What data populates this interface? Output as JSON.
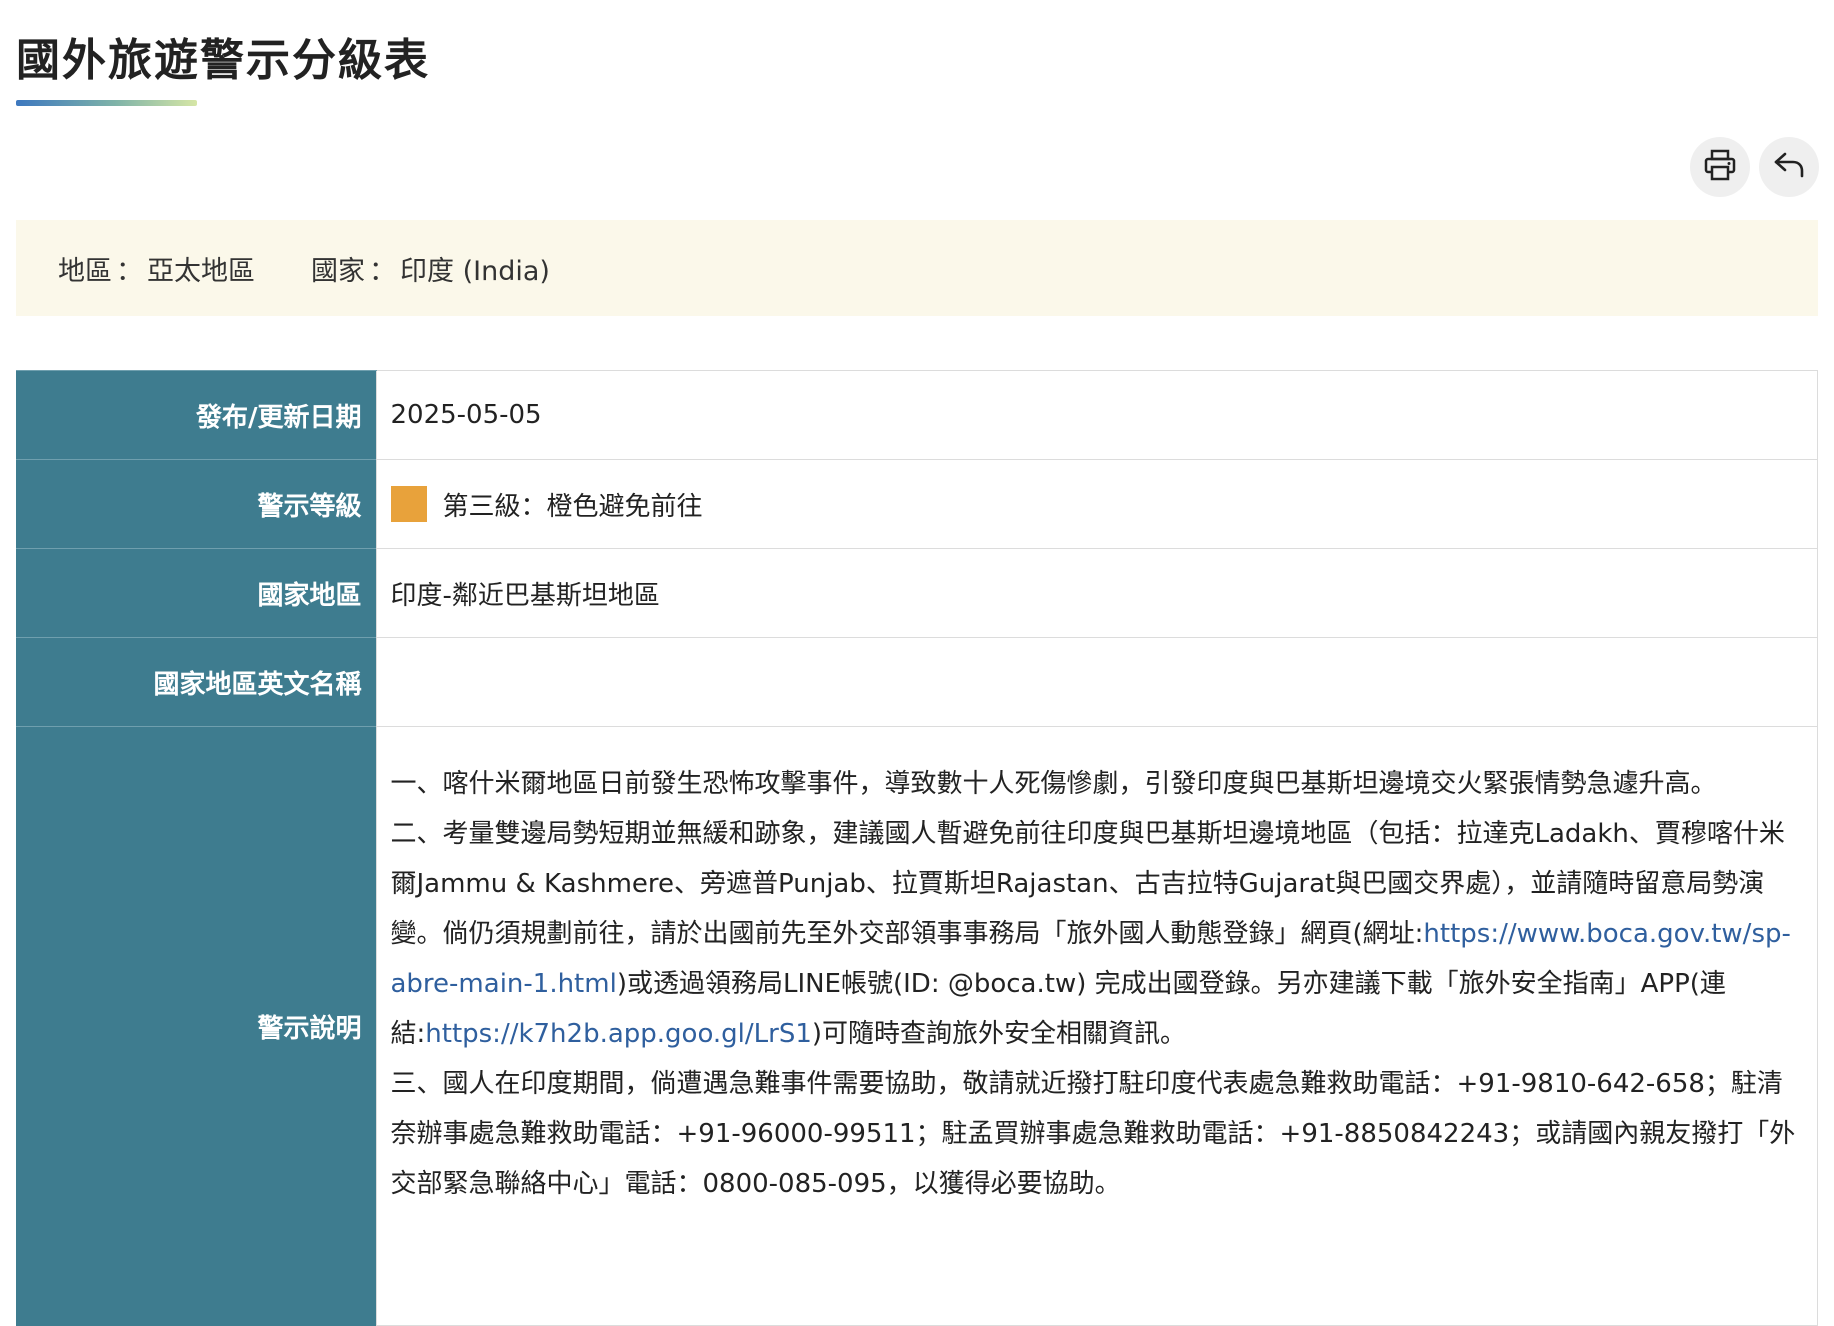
{
  "page": {
    "title": "國外旅遊警示分級表"
  },
  "toolbar": {
    "print_icon": "printer-icon",
    "back_icon": "undo-arrow-icon"
  },
  "info": {
    "region_label": "地區",
    "region_value": "亞太地區",
    "country_label": "國家",
    "country_value": "印度 (India)",
    "separator": "："
  },
  "table": {
    "rows": {
      "date": {
        "label": "發布/更新日期",
        "value": "2025-05-05"
      },
      "level": {
        "label": "警示等級",
        "value": "第三級：橙色避免前往",
        "color": "#e8a23b"
      },
      "area": {
        "label": "國家地區",
        "value": "印度-鄰近巴基斯坦地區"
      },
      "area_en": {
        "label": "國家地區英文名稱",
        "value": ""
      },
      "desc": {
        "label": "警示說明"
      }
    },
    "description": {
      "p1": "一、喀什米爾地區日前發生恐怖攻擊事件，導致數十人死傷慘劇，引發印度與巴基斯坦邊境交火緊張情勢急遽升高。",
      "p2_a": "二、考量雙邊局勢短期並無緩和跡象，建議國人暫避免前往印度與巴基斯坦邊境地區（包括：拉達克Ladakh、賈穆喀什米爾Jammu & Kashmere、旁遮普Punjab、拉賈斯坦Rajastan、古吉拉特Gujarat與巴國交界處），並請隨時留意局勢演變。倘仍須規劃前往，請於出國前先至外交部領事事務局「旅外國人動態登錄」網頁(網址:",
      "p2_link1": "https://www.boca.gov.tw/sp-abre-main-1.html",
      "p2_b": ")或透過領務局LINE帳號(ID: @boca.tw) 完成出國登錄。另亦建議下載「旅外安全指南」APP(連結:",
      "p2_link2": "https://k7h2b.app.goo.gl/LrS1",
      "p2_c": ")可隨時查詢旅外安全相關資訊。",
      "p3": "三、國人在印度期間，倘遭遇急難事件需要協助，敬請就近撥打駐印度代表處急難救助電話：+91-9810-642-658；駐清奈辦事處急難救助電話：+91-96000-99511；駐孟買辦事處急難救助電話：+91-8850842243；或請國內親友撥打「外交部緊急聯絡中心」電話：0800-085-095，以獲得必要協助。"
    },
    "colors": {
      "header_bg": "#3e7c8f",
      "link": "#2f5f9e"
    }
  }
}
